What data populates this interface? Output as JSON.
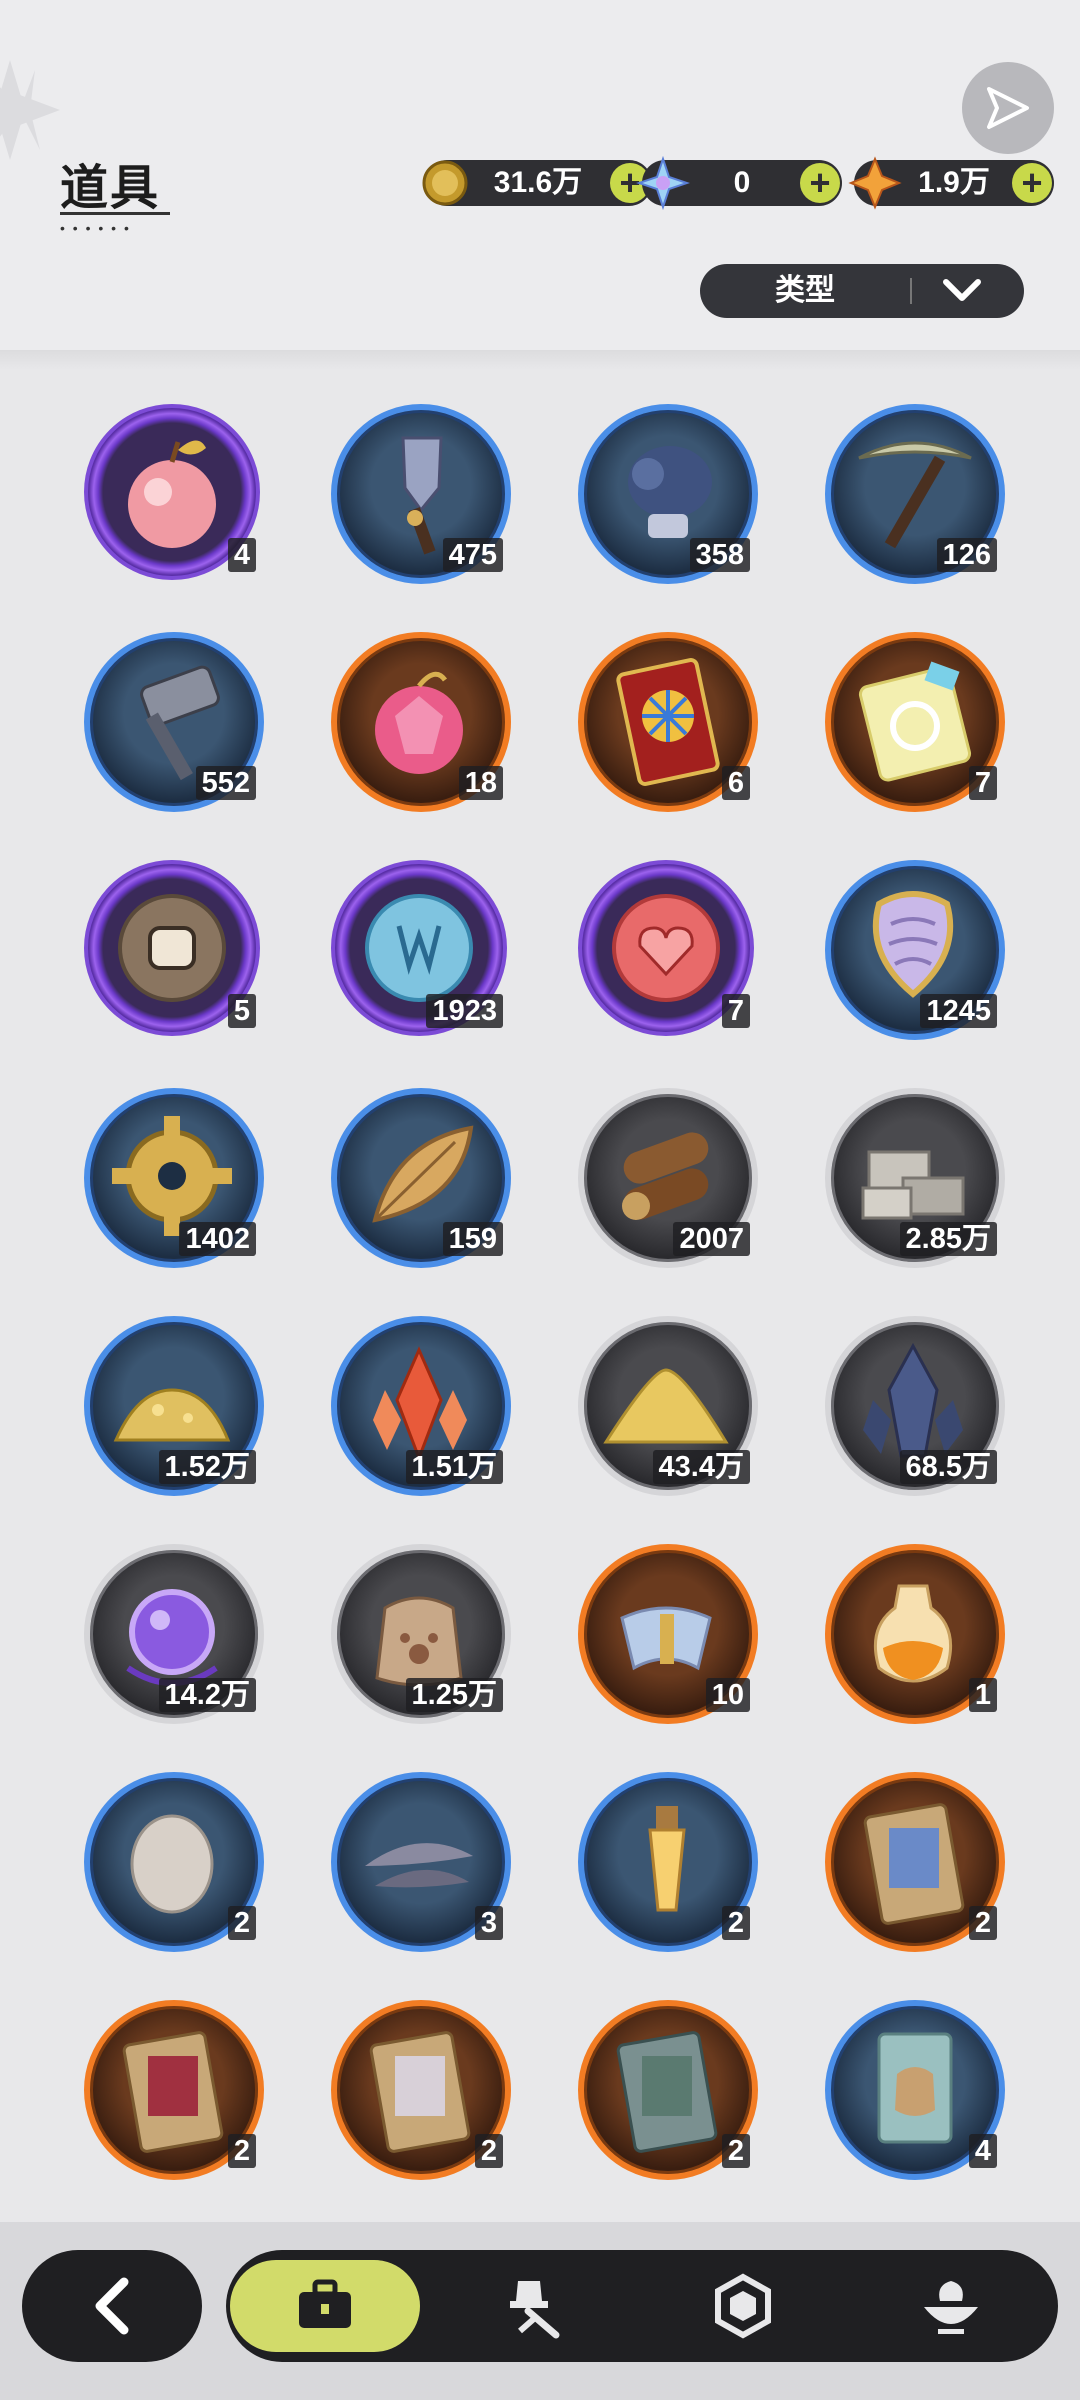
{
  "header": {
    "title": "道具",
    "currencies": [
      {
        "name": "gold-coin",
        "value": "31.6万"
      },
      {
        "name": "star-crystal",
        "value": "0"
      },
      {
        "name": "orange-crystal",
        "value": "1.9万"
      }
    ],
    "filter_label": "类型"
  },
  "items": [
    {
      "icon": "pink-apple",
      "rarity": "purple",
      "qty": "4"
    },
    {
      "icon": "shovel",
      "rarity": "blue",
      "qty": "475"
    },
    {
      "icon": "glove",
      "rarity": "blue",
      "qty": "358"
    },
    {
      "icon": "pickaxe",
      "rarity": "blue",
      "qty": "126"
    },
    {
      "icon": "hammer",
      "rarity": "blue",
      "qty": "552"
    },
    {
      "icon": "crystal-apple",
      "rarity": "orange",
      "qty": "18"
    },
    {
      "icon": "wheel-ticket",
      "rarity": "orange",
      "qty": "6"
    },
    {
      "icon": "rainbow-ticket",
      "rarity": "orange",
      "qty": "7"
    },
    {
      "icon": "fist-coin",
      "rarity": "purple",
      "qty": "5"
    },
    {
      "icon": "blue-coin",
      "rarity": "purple",
      "qty": "1923"
    },
    {
      "icon": "heart-coin",
      "rarity": "purple",
      "qty": "7"
    },
    {
      "icon": "scale-badge",
      "rarity": "blue",
      "qty": "1245"
    },
    {
      "icon": "gear",
      "rarity": "blue",
      "qty": "1402"
    },
    {
      "icon": "leaf",
      "rarity": "blue",
      "qty": "159"
    },
    {
      "icon": "wood-logs",
      "rarity": "grey",
      "qty": "2007"
    },
    {
      "icon": "stone-bricks",
      "rarity": "grey",
      "qty": "2.85万"
    },
    {
      "icon": "gold-ore",
      "rarity": "blue",
      "qty": "1.52万"
    },
    {
      "icon": "red-crystal",
      "rarity": "blue",
      "qty": "1.51万"
    },
    {
      "icon": "sand-pile",
      "rarity": "grey",
      "qty": "43.4万"
    },
    {
      "icon": "dark-crystal",
      "rarity": "grey",
      "qty": "68.5万"
    },
    {
      "icon": "purple-orb",
      "rarity": "grey",
      "qty": "14.2万"
    },
    {
      "icon": "paw-bag",
      "rarity": "grey",
      "qty": "1.25万"
    },
    {
      "icon": "scroll",
      "rarity": "orange",
      "qty": "10"
    },
    {
      "icon": "potion",
      "rarity": "orange",
      "qty": "1"
    },
    {
      "icon": "egg",
      "rarity": "blue",
      "qty": "2"
    },
    {
      "icon": "feathers",
      "rarity": "blue",
      "qty": "3"
    },
    {
      "icon": "vial",
      "rarity": "blue",
      "qty": "2"
    },
    {
      "icon": "album-blue",
      "rarity": "orange",
      "qty": "2"
    },
    {
      "icon": "album-red",
      "rarity": "orange",
      "qty": "2"
    },
    {
      "icon": "album-white",
      "rarity": "orange",
      "qty": "2"
    },
    {
      "icon": "album-green",
      "rarity": "orange",
      "qty": "2"
    },
    {
      "icon": "card",
      "rarity": "blue",
      "qty": "4"
    }
  ],
  "nav": {
    "tabs": [
      {
        "icon": "bag-icon",
        "active": true
      },
      {
        "icon": "hat-sword-icon",
        "active": false
      },
      {
        "icon": "hexagon-icon",
        "active": false
      },
      {
        "icon": "bowl-icon",
        "active": false
      }
    ]
  },
  "colors": {
    "purple_ring": "#7c4bd6",
    "blue_ring": "#4a8ee8",
    "orange_ring": "#f27c23",
    "grey_ring": "#d5d5d8",
    "accent_lime": "#d2db6a",
    "plus_green": "#c8d94a",
    "bar_dark": "#1f1f22"
  }
}
